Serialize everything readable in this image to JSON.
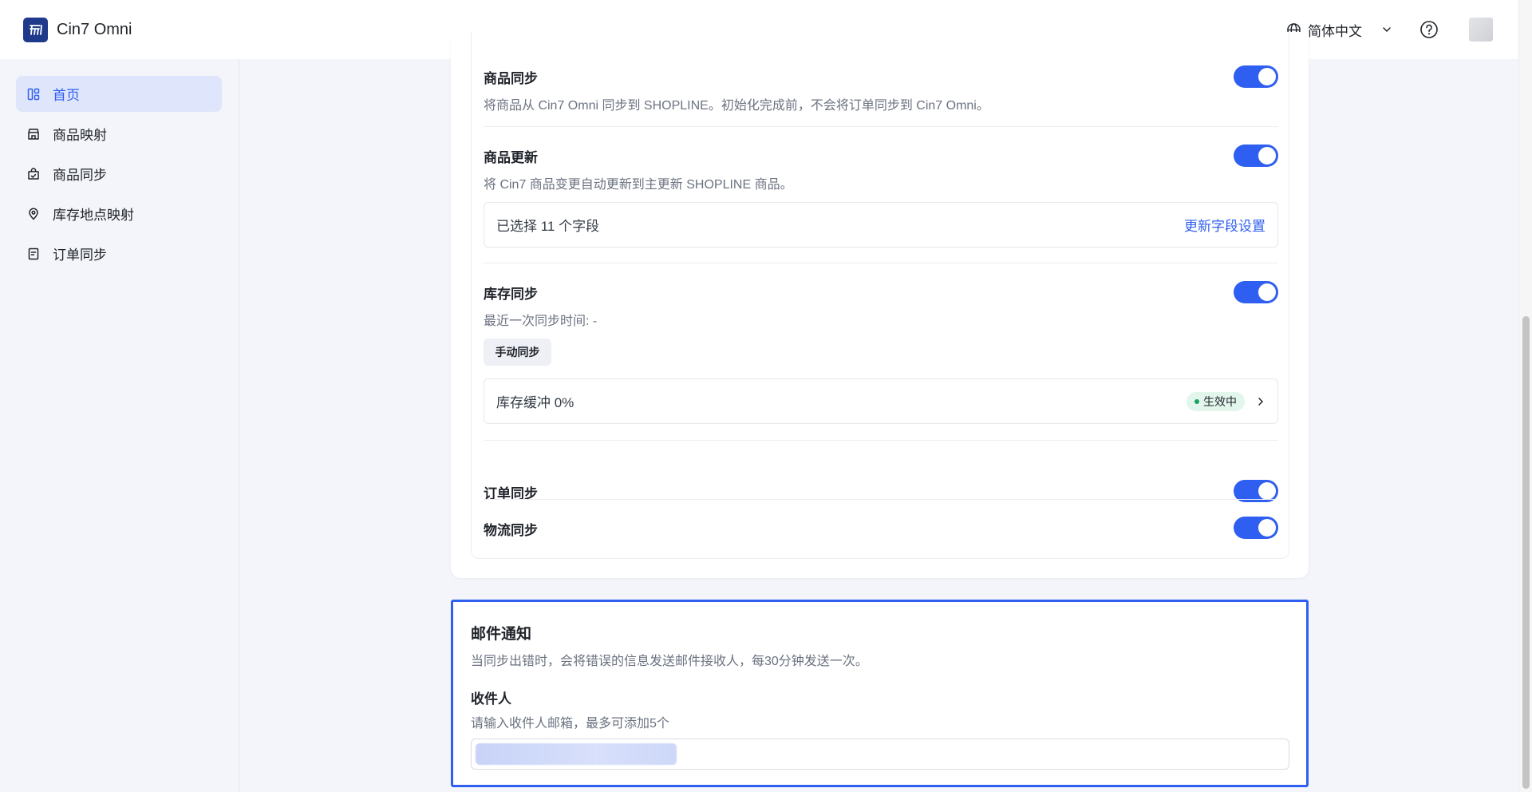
{
  "app": {
    "name": "Cin7 Omni",
    "language": "简体中文"
  },
  "sidebar": {
    "items": [
      {
        "label": "首页",
        "active": true,
        "icon": "dashboard-icon"
      },
      {
        "label": "商品映射",
        "active": false,
        "icon": "shop-icon"
      },
      {
        "label": "商品同步",
        "active": false,
        "icon": "bag-sync-icon"
      },
      {
        "label": "库存地点映射",
        "active": false,
        "icon": "location-pin-icon"
      },
      {
        "label": "订单同步",
        "active": false,
        "icon": "order-doc-icon"
      }
    ]
  },
  "sync": {
    "product_sync": {
      "title": "商品同步",
      "desc": "将商品从 Cin7 Omni 同步到 SHOPLINE。初始化完成前，不会将订单同步到 Cin7 Omni。",
      "enabled": true
    },
    "product_update": {
      "title": "商品更新",
      "desc": "将 Cin7 商品变更自动更新到主更新 SHOPLINE 商品。",
      "enabled": true,
      "fields_selected": "已选择 11 个字段",
      "fields_link": "更新字段设置"
    },
    "inventory_sync": {
      "title": "库存同步",
      "last_sync": "最近一次同步时间: -",
      "enabled": true,
      "manual_button": "手动同步",
      "buffer_label": "库存缓冲 0%",
      "buffer_status": "生效中",
      "status_color": "#1aa260"
    },
    "order_sync": {
      "title": "订单同步",
      "enabled": true
    },
    "logistics_sync": {
      "title": "物流同步",
      "enabled": true
    }
  },
  "email": {
    "title": "邮件通知",
    "desc": "当同步出错时，会将错误的信息发送邮件接收人，每30分钟发送一次。",
    "recipients_label": "收件人",
    "recipients_desc": "请输入收件人邮箱，最多可添加5个"
  },
  "colors": {
    "accent": "#2f5ff0",
    "brand": "#1f3a8a"
  }
}
